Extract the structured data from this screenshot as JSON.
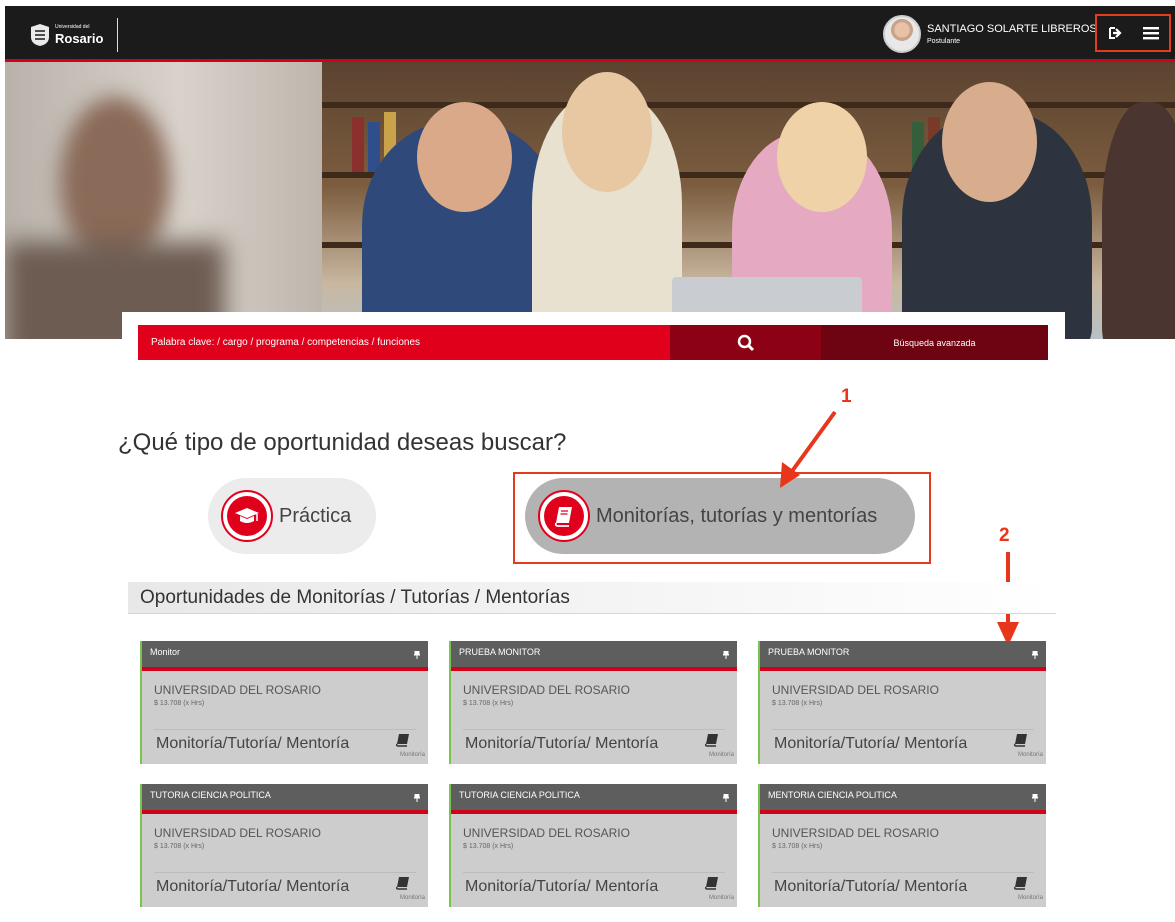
{
  "header": {
    "logo_small": "Universidad del",
    "logo_big": "Rosario",
    "user_name": "SANTIAGO SOLARTE LIBREROS",
    "user_role": "Postulante"
  },
  "search": {
    "placeholder": "Palabra clave: / cargo / programa / competencias / funciones",
    "advanced_label": "Búsqueda avanzada"
  },
  "question": "¿Qué tipo de oportunidad deseas buscar?",
  "options": [
    {
      "label": "Práctica",
      "icon": "graduation-cap-icon"
    },
    {
      "label": "Monitorías, tutorías y mentorías",
      "icon": "book-icon"
    }
  ],
  "annotations": {
    "one": "1",
    "two": "2"
  },
  "section_title": "Oportunidades de Monitorías / Tutorías / Mentorías",
  "cards": [
    {
      "title": "Monitor",
      "company": "UNIVERSIDAD DEL ROSARIO",
      "salary": "$ 13.708 (x Hrs)",
      "type": "Monitoría/Tutoría/ Mentoría",
      "icon_label": "Monitoría"
    },
    {
      "title": "PRUEBA MONITOR",
      "company": "UNIVERSIDAD DEL ROSARIO",
      "salary": "$ 13.708 (x Hrs)",
      "type": "Monitoría/Tutoría/ Mentoría",
      "icon_label": "Monitoría"
    },
    {
      "title": "PRUEBA MONITOR",
      "company": "UNIVERSIDAD DEL ROSARIO",
      "salary": "$ 13.708 (x Hrs)",
      "type": "Monitoría/Tutoría/ Mentoría",
      "icon_label": "Monitoría"
    },
    {
      "title": "TUTORIA CIENCIA POLITICA",
      "company": "UNIVERSIDAD DEL ROSARIO",
      "salary": "$ 13.708 (x Hrs)",
      "type": "Monitoría/Tutoría/ Mentoría",
      "icon_label": "Monitoría"
    },
    {
      "title": "TUTORIA CIENCIA POLITICA",
      "company": "UNIVERSIDAD DEL ROSARIO",
      "salary": "$ 13.708 (x Hrs)",
      "type": "Monitoría/Tutoría/ Mentoría",
      "icon_label": "Monitoría"
    },
    {
      "title": "MENTORIA CIENCIA POLITICA",
      "company": "UNIVERSIDAD DEL ROSARIO",
      "salary": "$ 13.708 (x Hrs)",
      "type": "Monitoría/Tutoría/ Mentoría",
      "icon_label": "Monitoría"
    }
  ],
  "colors": {
    "brand_red": "#e0001b",
    "dark_red": "#8c0114",
    "header": "#1b1b1b",
    "annotation": "#e33b1c",
    "card_accent": "#7cc24e"
  }
}
